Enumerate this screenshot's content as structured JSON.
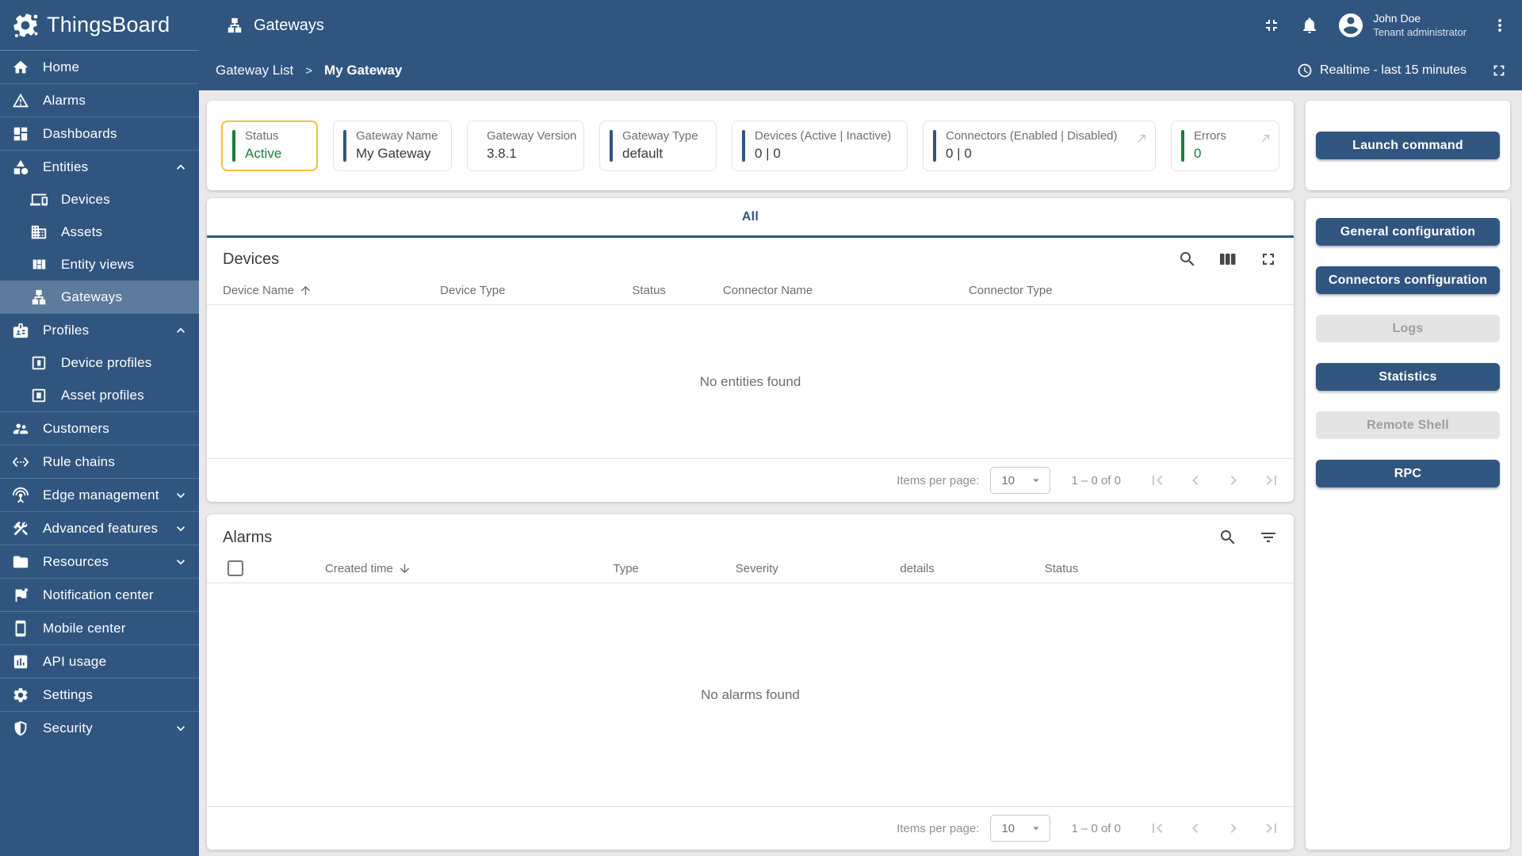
{
  "colors": {
    "primary": "#305680",
    "sidebar_selected_bg": "rgba(255,255,255,0.22)",
    "content_bg": "#e9e9e9",
    "green": "#188038",
    "selected_card_border": "#f1c232",
    "disabled_button_bg": "#e4e4e4",
    "disabled_button_text": "#9e9e9e"
  },
  "header": {
    "brand": "ThingsBoard",
    "page_title": "Gateways",
    "user_name": "John Doe",
    "user_role": "Tenant administrator"
  },
  "breadcrumb": {
    "parent": "Gateway List",
    "separator": ">",
    "current": "My Gateway",
    "timewindow": "Realtime - last 15 minutes"
  },
  "sidebar": {
    "items": [
      {
        "label": "Home",
        "icon": "home"
      },
      {
        "label": "Alarms",
        "icon": "warning"
      },
      {
        "label": "Dashboards",
        "icon": "dashboard"
      },
      {
        "label": "Entities",
        "icon": "category",
        "expanded": true
      },
      {
        "label": "Devices",
        "icon": "devices"
      },
      {
        "label": "Assets",
        "icon": "domain"
      },
      {
        "label": "Entity views",
        "icon": "view-quilt"
      },
      {
        "label": "Gateways",
        "icon": "lan",
        "selected": true
      },
      {
        "label": "Profiles",
        "icon": "badge",
        "expanded": true
      },
      {
        "label": "Device profiles",
        "icon": "device-profile"
      },
      {
        "label": "Asset profiles",
        "icon": "asset-profile"
      },
      {
        "label": "Customers",
        "icon": "people"
      },
      {
        "label": "Rule chains",
        "icon": "settings-ethernet"
      },
      {
        "label": "Edge management",
        "icon": "antenna",
        "collapsed": true
      },
      {
        "label": "Advanced features",
        "icon": "construction",
        "collapsed": true
      },
      {
        "label": "Resources",
        "icon": "folder",
        "collapsed": true
      },
      {
        "label": "Notification center",
        "icon": "flag"
      },
      {
        "label": "Mobile center",
        "icon": "smartphone"
      },
      {
        "label": "API usage",
        "icon": "insert-chart"
      },
      {
        "label": "Settings",
        "icon": "settings"
      },
      {
        "label": "Security",
        "icon": "shield",
        "collapsed": true
      }
    ]
  },
  "status_cards": [
    {
      "label": "Status",
      "value": "Active",
      "accent": "green",
      "selected": true
    },
    {
      "label": "Gateway Name",
      "value": "My Gateway",
      "accent": "blue"
    },
    {
      "label": "Gateway Version",
      "value": "3.8.1",
      "accent": "blue"
    },
    {
      "label": "Gateway Type",
      "value": "default",
      "accent": "blue"
    },
    {
      "label": "Devices (Active | Inactive)",
      "value": "0 | 0",
      "accent": "blue"
    },
    {
      "label": "Connectors (Enabled | Disabled)",
      "value": "0 | 0",
      "accent": "blue",
      "link": true
    },
    {
      "label": "Errors",
      "value": "0",
      "accent": "green",
      "link": true
    }
  ],
  "tabs": {
    "all": "All"
  },
  "devices": {
    "title": "Devices",
    "columns": [
      "Device Name",
      "Device Type",
      "Status",
      "Connector Name",
      "Connector Type"
    ],
    "sort": {
      "column": "Device Name",
      "direction": "asc"
    },
    "empty": "No entities found",
    "pagination": {
      "items_per_page_label": "Items per page:",
      "page_size": "10",
      "range": "1 – 0 of 0"
    }
  },
  "alarms": {
    "title": "Alarms",
    "columns": [
      "Created time",
      "Type",
      "Severity",
      "details",
      "Status"
    ],
    "sort": {
      "column": "Created time",
      "direction": "desc"
    },
    "empty": "No alarms found",
    "pagination": {
      "items_per_page_label": "Items per page:",
      "page_size": "10",
      "range": "1 – 0 of 0"
    }
  },
  "actions": {
    "launch": "Launch command",
    "general": "General configuration",
    "connectors": "Connectors configuration",
    "logs": "Logs",
    "statistics": "Statistics",
    "remote_shell": "Remote Shell",
    "rpc": "RPC"
  }
}
